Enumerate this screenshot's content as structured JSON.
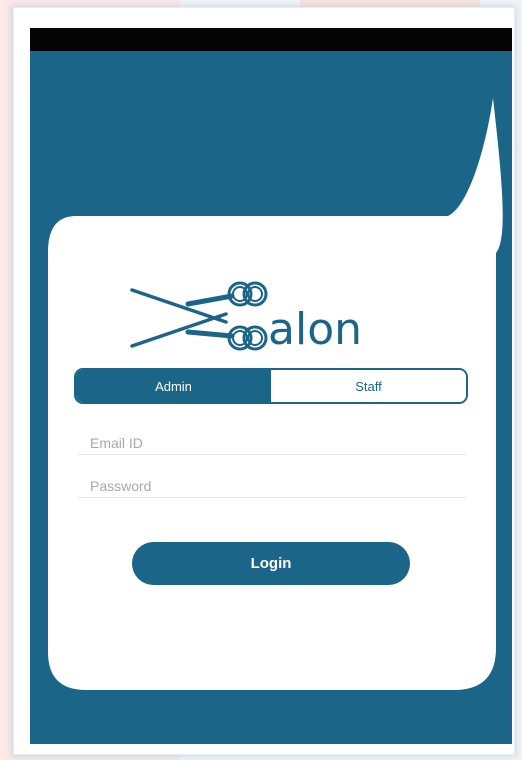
{
  "app": {
    "name": "Salon",
    "logo_text": "alon"
  },
  "tabs": [
    {
      "label": "Admin",
      "selected": true
    },
    {
      "label": "Staff",
      "selected": false
    }
  ],
  "form": {
    "email": {
      "placeholder": "Email ID",
      "value": ""
    },
    "password": {
      "placeholder": "Password",
      "value": ""
    },
    "login_label": "Login"
  },
  "colors": {
    "primary": "#1b6589",
    "card": "#ffffff",
    "status_bar": "#050505"
  },
  "icons": {
    "logo_glyph": "scissors-icon"
  }
}
